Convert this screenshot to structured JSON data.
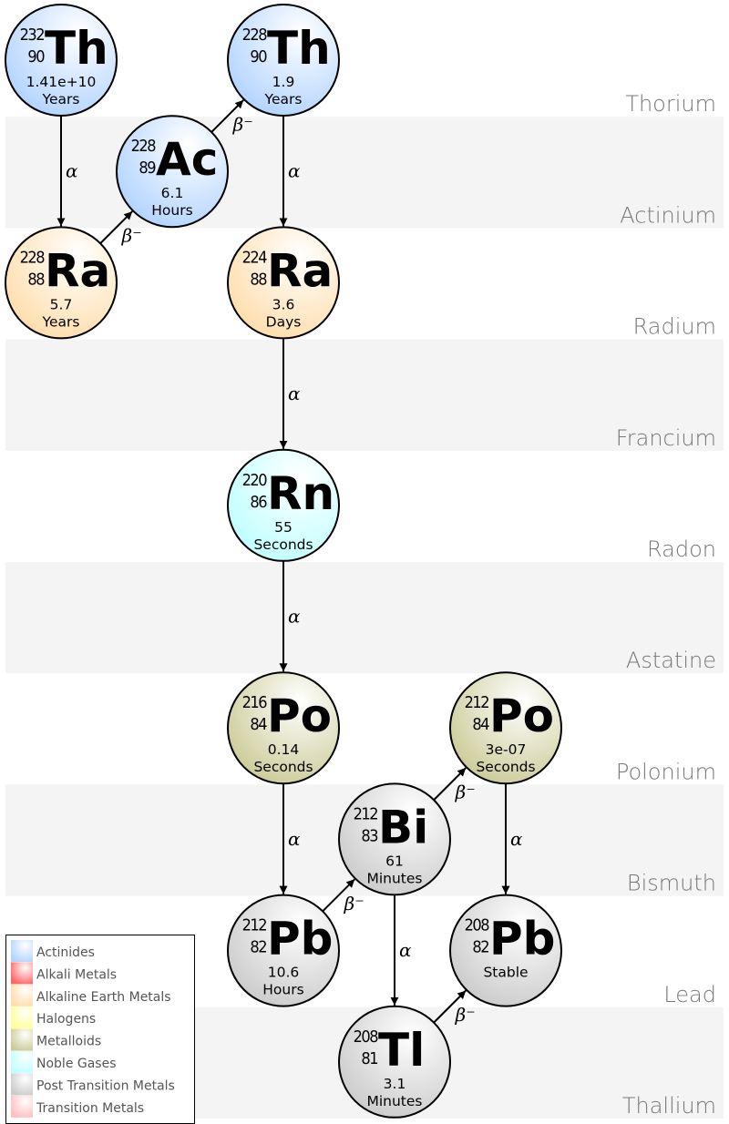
{
  "bands": [
    {
      "label": "Thorium"
    },
    {
      "label": "Actinium"
    },
    {
      "label": "Radium"
    },
    {
      "label": "Francium"
    },
    {
      "label": "Radon"
    },
    {
      "label": "Astatine"
    },
    {
      "label": "Polonium"
    },
    {
      "label": "Bismuth"
    },
    {
      "label": "Lead"
    },
    {
      "label": "Thallium"
    }
  ],
  "nuclides": [
    {
      "id": "th232",
      "symbol": "Th",
      "mass": "232",
      "atomic": "90",
      "halflife": "1.41e+10",
      "unit": "Years",
      "category": "actinides",
      "col": 0,
      "row": 0
    },
    {
      "id": "ra228",
      "symbol": "Ra",
      "mass": "228",
      "atomic": "88",
      "halflife": "5.7",
      "unit": "Years",
      "category": "alkaline-earth",
      "col": 0,
      "row": 2
    },
    {
      "id": "ac228",
      "symbol": "Ac",
      "mass": "228",
      "atomic": "89",
      "halflife": "6.1",
      "unit": "Hours",
      "category": "actinides",
      "col": 1,
      "row": 1
    },
    {
      "id": "th228",
      "symbol": "Th",
      "mass": "228",
      "atomic": "90",
      "halflife": "1.9",
      "unit": "Years",
      "category": "actinides",
      "col": 2,
      "row": 0
    },
    {
      "id": "ra224",
      "symbol": "Ra",
      "mass": "224",
      "atomic": "88",
      "halflife": "3.6",
      "unit": "Days",
      "category": "alkaline-earth",
      "col": 2,
      "row": 2
    },
    {
      "id": "rn220",
      "symbol": "Rn",
      "mass": "220",
      "atomic": "86",
      "halflife": "55",
      "unit": "Seconds",
      "category": "noble-gases",
      "col": 2,
      "row": 4
    },
    {
      "id": "po216",
      "symbol": "Po",
      "mass": "216",
      "atomic": "84",
      "halflife": "0.14",
      "unit": "Seconds",
      "category": "metalloids",
      "col": 2,
      "row": 6
    },
    {
      "id": "pb212",
      "symbol": "Pb",
      "mass": "212",
      "atomic": "82",
      "halflife": "10.6",
      "unit": "Hours",
      "category": "post-transition",
      "col": 2,
      "row": 8
    },
    {
      "id": "bi212",
      "symbol": "Bi",
      "mass": "212",
      "atomic": "83",
      "halflife": "61",
      "unit": "Minutes",
      "category": "post-transition",
      "col": 3,
      "row": 7
    },
    {
      "id": "po212",
      "symbol": "Po",
      "mass": "212",
      "atomic": "84",
      "halflife": "3e-07",
      "unit": "Seconds",
      "category": "metalloids",
      "col": 4,
      "row": 6
    },
    {
      "id": "tl208",
      "symbol": "Tl",
      "mass": "208",
      "atomic": "81",
      "halflife": "3.1",
      "unit": "Minutes",
      "category": "post-transition",
      "col": 3,
      "row": 9
    },
    {
      "id": "pb208",
      "symbol": "Pb",
      "mass": "208",
      "atomic": "82",
      "halflife": "Stable",
      "unit": "",
      "category": "post-transition",
      "col": 4,
      "row": 8
    }
  ],
  "decays": [
    {
      "from": "th232",
      "to": "ra228",
      "mode": "α"
    },
    {
      "from": "ra228",
      "to": "ac228",
      "mode": "β⁻"
    },
    {
      "from": "ac228",
      "to": "th228",
      "mode": "β⁻"
    },
    {
      "from": "th228",
      "to": "ra224",
      "mode": "α"
    },
    {
      "from": "ra224",
      "to": "rn220",
      "mode": "α"
    },
    {
      "from": "rn220",
      "to": "po216",
      "mode": "α"
    },
    {
      "from": "po216",
      "to": "pb212",
      "mode": "α"
    },
    {
      "from": "pb212",
      "to": "bi212",
      "mode": "β⁻"
    },
    {
      "from": "bi212",
      "to": "po212",
      "mode": "β⁻"
    },
    {
      "from": "bi212",
      "to": "tl208",
      "mode": "α"
    },
    {
      "from": "po212",
      "to": "pb208",
      "mode": "α"
    },
    {
      "from": "tl208",
      "to": "pb208",
      "mode": "β⁻"
    }
  ],
  "legend": {
    "items": [
      {
        "key": "actinides",
        "label": "Actinides",
        "color": "#b3d4ff"
      },
      {
        "key": "alkali",
        "label": "Alkali Metals",
        "color": "#ff6666"
      },
      {
        "key": "alkaline-earth",
        "label": "Alkaline Earth Metals",
        "color": "#ffdead"
      },
      {
        "key": "halogens",
        "label": "Halogens",
        "color": "#ffff99"
      },
      {
        "key": "metalloids",
        "label": "Metalloids",
        "color": "#cccc99"
      },
      {
        "key": "noble-gases",
        "label": "Noble Gases",
        "color": "#c0ffff"
      },
      {
        "key": "post-transition",
        "label": "Post Transition Metals",
        "color": "#cccccc"
      },
      {
        "key": "transition",
        "label": "Transition Metals",
        "color": "#ffc0c0"
      }
    ]
  }
}
